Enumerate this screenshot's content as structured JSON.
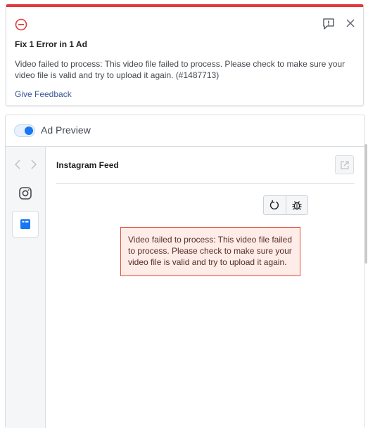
{
  "error_card": {
    "title": "Fix 1 Error in 1 Ad",
    "message": "Video failed to process: This video file failed to process. Please check to make sure your video file is valid and try to upload it again. (#1487713)",
    "feedback_link": "Give Feedback",
    "icons": {
      "error": "minus-circle-icon",
      "feedback": "feedback-exclamation-icon",
      "close": "close-icon"
    },
    "accent_color": "#e0393e"
  },
  "preview": {
    "toggle_on": true,
    "title": "Ad Preview",
    "placement_title": "Instagram Feed",
    "rail_icons": [
      "chevron-left-icon",
      "chevron-right-icon",
      "instagram-icon",
      "feed-placement-icon"
    ],
    "toolbar_icons": [
      "refresh-icon",
      "bug-icon",
      "open-external-icon"
    ],
    "error_message": "Video failed to process: This video file failed to process. Please check to make sure your video file is valid and try to upload it again.",
    "toggle_color": "#1877f2",
    "error_box_color": "#fdece8"
  }
}
